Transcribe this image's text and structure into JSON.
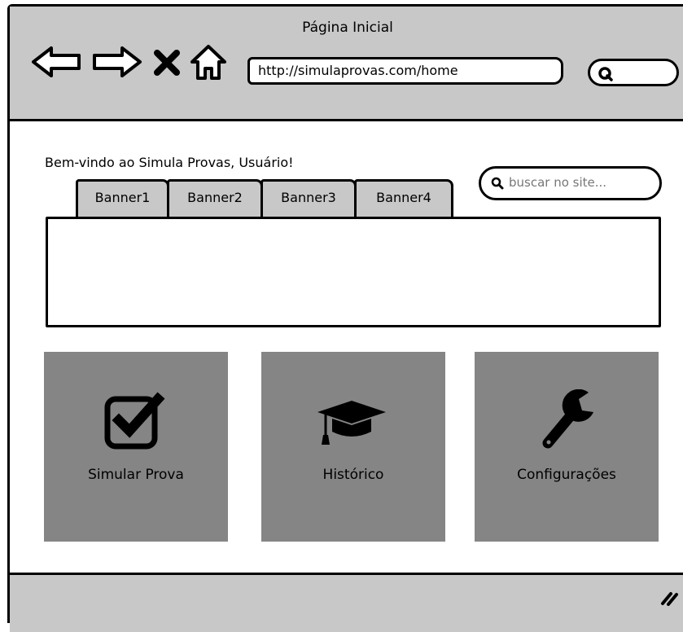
{
  "window": {
    "title": "Página Inicial"
  },
  "toolbar": {
    "url": "http://simulaprovas.com/home",
    "buttons": [
      "back-icon",
      "forward-icon",
      "close-icon",
      "home-icon"
    ]
  },
  "page": {
    "welcome": "Bem-vindo ao Simula Provas, Usuário!",
    "search_placeholder": "buscar no site...",
    "tabs": [
      "Banner1",
      "Banner2",
      "Banner3",
      "Banner4"
    ],
    "tiles": [
      {
        "label": "Simular Prova",
        "icon": "checkbox-check-icon"
      },
      {
        "label": "Histórico",
        "icon": "graduation-cap-icon"
      },
      {
        "label": "Configurações",
        "icon": "wrench-icon"
      }
    ]
  },
  "colors": {
    "chrome": "#c8c8c8",
    "tile": "#858585",
    "border": "#000000"
  }
}
